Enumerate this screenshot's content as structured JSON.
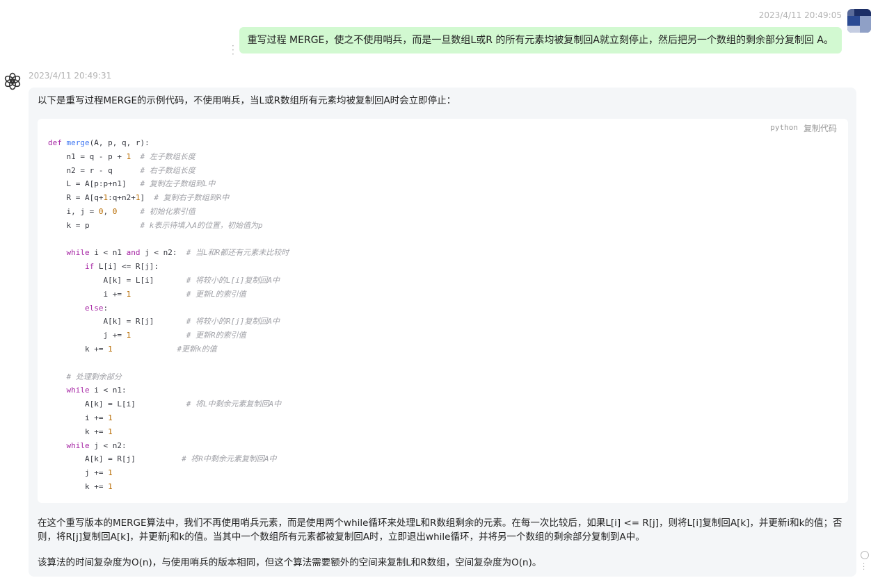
{
  "user_message": {
    "timestamp": "2023/4/11 20:49:05",
    "text": "重写过程 MERGE，使之不使用哨兵，而是一旦数组L或R 的所有元素均被复制回A就立刻停止，然后把另一个数组的剩余部分复制回 A。",
    "avatar_icon": "user-avatar-icon",
    "bubble_color": "#d2f9d1"
  },
  "bot_message": {
    "timestamp": "2023/4/11 20:49:31",
    "avatar_icon": "openai-logo-icon",
    "intro": "以下是重写过程MERGE的示例代码，不使用哨兵，当L或R数组所有元素均被复制回A时会立即停止：",
    "code_block": {
      "language": "python",
      "copy_label": "复制代码",
      "lines": [
        [
          [
            "kw",
            "def "
          ],
          [
            "fn",
            "merge"
          ],
          [
            "t",
            "(A, p, q, r):"
          ]
        ],
        [
          [
            "t",
            "    n1 = q - p + "
          ],
          [
            "num",
            "1"
          ],
          [
            "t",
            "  "
          ],
          [
            "cm",
            "# 左子数组长度"
          ]
        ],
        [
          [
            "t",
            "    n2 = r - q      "
          ],
          [
            "cm",
            "# 右子数组长度"
          ]
        ],
        [
          [
            "t",
            "    L = A[p:p+n1]   "
          ],
          [
            "cm",
            "# 复制左子数组到L中"
          ]
        ],
        [
          [
            "t",
            "    R = A[q+"
          ],
          [
            "num",
            "1"
          ],
          [
            "t",
            ":q+n2+"
          ],
          [
            "num",
            "1"
          ],
          [
            "t",
            "]  "
          ],
          [
            "cm",
            "# 复制右子数组到R中"
          ]
        ],
        [
          [
            "t",
            "    i, j = "
          ],
          [
            "num",
            "0"
          ],
          [
            "t",
            ", "
          ],
          [
            "num",
            "0"
          ],
          [
            "t",
            "     "
          ],
          [
            "cm",
            "# 初始化索引值"
          ]
        ],
        [
          [
            "t",
            "    k = p           "
          ],
          [
            "cm",
            "# k表示待填入A的位置，初始值为p"
          ]
        ],
        [
          [
            "t",
            ""
          ]
        ],
        [
          [
            "t",
            "    "
          ],
          [
            "kw",
            "while"
          ],
          [
            "t",
            " i < n1 "
          ],
          [
            "kw",
            "and"
          ],
          [
            "t",
            " j < n2:  "
          ],
          [
            "cm",
            "# 当L和R都还有元素未比较时"
          ]
        ],
        [
          [
            "t",
            "        "
          ],
          [
            "kw",
            "if"
          ],
          [
            "t",
            " L[i] <= R[j]:"
          ]
        ],
        [
          [
            "t",
            "            A[k] = L[i]       "
          ],
          [
            "cm",
            "# 将较小的L[i]复制回A中"
          ]
        ],
        [
          [
            "t",
            "            i += "
          ],
          [
            "num",
            "1"
          ],
          [
            "t",
            "            "
          ],
          [
            "cm",
            "# 更新L的索引值"
          ]
        ],
        [
          [
            "t",
            "        "
          ],
          [
            "kw",
            "else"
          ],
          [
            "t",
            ":"
          ]
        ],
        [
          [
            "t",
            "            A[k] = R[j]       "
          ],
          [
            "cm",
            "# 将较小的R[j]复制回A中"
          ]
        ],
        [
          [
            "t",
            "            j += "
          ],
          [
            "num",
            "1"
          ],
          [
            "t",
            "            "
          ],
          [
            "cm",
            "# 更新R的索引值"
          ]
        ],
        [
          [
            "t",
            "        k += "
          ],
          [
            "num",
            "1"
          ],
          [
            "t",
            "              "
          ],
          [
            "cm",
            "#更新k的值"
          ]
        ],
        [
          [
            "t",
            ""
          ]
        ],
        [
          [
            "t",
            "    "
          ],
          [
            "cm",
            "# 处理剩余部分"
          ]
        ],
        [
          [
            "t",
            "    "
          ],
          [
            "kw",
            "while"
          ],
          [
            "t",
            " i < n1:"
          ]
        ],
        [
          [
            "t",
            "        A[k] = L[i]           "
          ],
          [
            "cm",
            "# 将L中剩余元素复制回A中"
          ]
        ],
        [
          [
            "t",
            "        i += "
          ],
          [
            "num",
            "1"
          ]
        ],
        [
          [
            "t",
            "        k += "
          ],
          [
            "num",
            "1"
          ]
        ],
        [
          [
            "t",
            "    "
          ],
          [
            "kw",
            "while"
          ],
          [
            "t",
            " j < n2:"
          ]
        ],
        [
          [
            "t",
            "        A[k] = R[j]          "
          ],
          [
            "cm",
            "# 将R中剩余元素复制回A中"
          ]
        ],
        [
          [
            "t",
            "        j += "
          ],
          [
            "num",
            "1"
          ]
        ],
        [
          [
            "t",
            "        k += "
          ],
          [
            "num",
            "1"
          ]
        ]
      ]
    },
    "paragraph1": "在这个重写版本的MERGE算法中，我们不再使用哨兵元素，而是使用两个while循环来处理L和R数组剩余的元素。在每一次比较后，如果L[i] <= R[j]，则将L[i]复制回A[k]，并更新i和k的值；否则，将R[j]复制回A[k]，并更新j和k的值。当其中一个数组所有元素都被复制回A时，立即退出while循环，并将另一个数组的剩余部分复制到A中。",
    "paragraph2": "该算法的时间复杂度为O(n)，与使用哨兵的版本相同，但这个算法需要额外的空间来复制L和R数组，空间复杂度为O(n)。",
    "bubble_color": "#f4f6f8"
  }
}
